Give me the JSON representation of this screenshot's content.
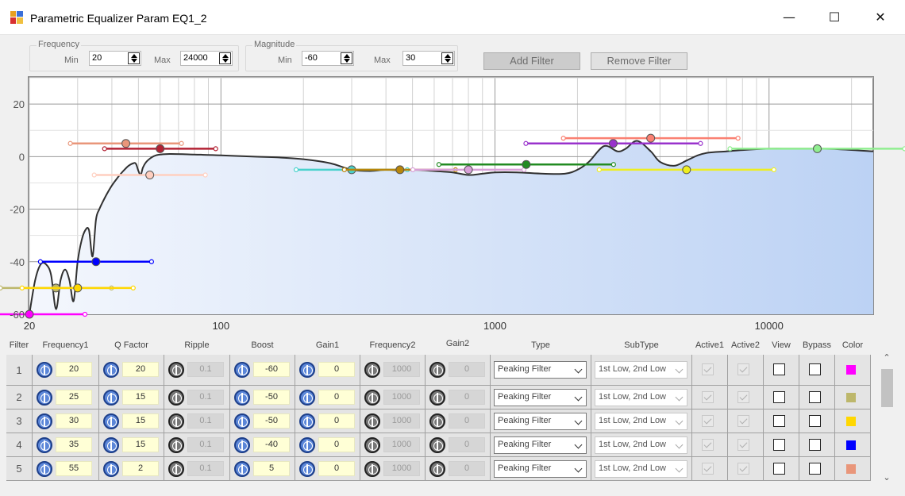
{
  "window": {
    "title": "Parametric Equalizer Param EQ1_2",
    "minimize_glyph": "—",
    "maximize_glyph": "☐",
    "close_glyph": "✕"
  },
  "frequency_group": {
    "label": "Frequency",
    "min_label": "Min",
    "min_value": "20",
    "max_label": "Max",
    "max_value": "24000"
  },
  "magnitude_group": {
    "label": "Magnitude",
    "min_label": "Min",
    "min_value": "-60",
    "max_label": "Max",
    "max_value": "30"
  },
  "buttons": {
    "add_filter": "Add Filter",
    "remove_filter": "Remove Filter"
  },
  "chart_data": {
    "type": "line",
    "x_scale": "log",
    "xlim": [
      20,
      24000
    ],
    "ylim": [
      -60,
      30
    ],
    "x_ticks": [
      20,
      100,
      1000,
      10000
    ],
    "x_tick_labels": [
      "20",
      "100",
      "1000",
      "10000"
    ],
    "y_ticks": [
      20,
      0,
      -20,
      -40,
      -60
    ],
    "y_tick_labels": [
      "20",
      "0",
      "-20",
      "-40",
      "-60"
    ],
    "grid": true,
    "series": [
      {
        "x": [
          20,
          21,
          22,
          23,
          24,
          25,
          26,
          27,
          28,
          29,
          30,
          31,
          32,
          33,
          34,
          35,
          36,
          38,
          40,
          42,
          44,
          46,
          48,
          49,
          50,
          51,
          52,
          54,
          58,
          65,
          80,
          100,
          130,
          160,
          200,
          250,
          300,
          350,
          400,
          450,
          500,
          600,
          700,
          800,
          900,
          1000,
          1200,
          1500,
          1800,
          2000,
          2200,
          2500,
          2800,
          3000,
          3300,
          3700,
          4000,
          4500,
          5000,
          5500,
          6000,
          7000,
          8000,
          10000,
          12000,
          15000,
          18000,
          24000
        ],
        "y": [
          -60,
          -47,
          -41,
          -41,
          -45,
          -58,
          -47,
          -43,
          -47,
          -55,
          -40,
          -32,
          -28,
          -28,
          -38,
          -24,
          -20,
          -15,
          -11,
          -8,
          -5.5,
          -3.5,
          -2.5,
          -2.8,
          -5.5,
          -7,
          -4,
          -1.5,
          0.5,
          1,
          0.8,
          0.5,
          0,
          -0.3,
          -1,
          -2.5,
          -5,
          -5.5,
          -5,
          -5.3,
          -5,
          -5.5,
          -6,
          -7,
          -6.5,
          -6,
          -6,
          -6.5,
          -6.5,
          -5,
          -2,
          4,
          2,
          3,
          6,
          2,
          -2,
          -3.5,
          -1.5,
          0.5,
          1.5,
          2,
          2.5,
          3,
          3,
          3,
          2.8,
          2
        ]
      }
    ],
    "filter_markers": [
      {
        "freq": 20,
        "gain": -60,
        "color": "#ff00ff"
      },
      {
        "freq": 25,
        "gain": -50,
        "color": "#bdb76b"
      },
      {
        "freq": 30,
        "gain": -50,
        "color": "#ffd700"
      },
      {
        "freq": 35,
        "gain": -40,
        "color": "#0000ff"
      },
      {
        "freq": 55,
        "gain": -7,
        "color": "#ffcfc0"
      },
      {
        "freq": 45,
        "gain": 5,
        "color": "#e9967a"
      },
      {
        "freq": 60,
        "gain": 3,
        "color": "#b22234"
      },
      {
        "freq": 300,
        "gain": -5,
        "color": "#48d1cc"
      },
      {
        "freq": 450,
        "gain": -5,
        "color": "#b8860b"
      },
      {
        "freq": 800,
        "gain": -5,
        "color": "#d8a0d8"
      },
      {
        "freq": 1300,
        "gain": -3,
        "color": "#228b22"
      },
      {
        "freq": 2700,
        "gain": 5,
        "color": "#9932cc"
      },
      {
        "freq": 3700,
        "gain": 7,
        "color": "#fa8072"
      },
      {
        "freq": 5000,
        "gain": -5,
        "color": "#eeee20"
      },
      {
        "freq": 15000,
        "gain": 3,
        "color": "#90ee90"
      }
    ]
  },
  "table": {
    "headers": {
      "filter": "Filter",
      "frequency1": "Frequency1",
      "q_factor": "Q Factor",
      "ripple": "Ripple",
      "boost": "Boost",
      "gain1": "Gain1",
      "frequency2": "Frequency2",
      "gain2": "Gain2",
      "type": "Type",
      "subtype": "SubType",
      "active1": "Active1",
      "active2": "Active2",
      "view": "View",
      "bypass": "Bypass",
      "color": "Color"
    },
    "rows": [
      {
        "num": "1",
        "freq1": "20",
        "q": "20",
        "ripple": "0.1",
        "boost": "-60",
        "gain1": "0",
        "freq2": "1000",
        "gain2": "0",
        "type": "Peaking Filter",
        "subtype": "1st Low, 2nd Low",
        "color": "#ff00ff"
      },
      {
        "num": "2",
        "freq1": "25",
        "q": "15",
        "ripple": "0.1",
        "boost": "-50",
        "gain1": "0",
        "freq2": "1000",
        "gain2": "0",
        "type": "Peaking Filter",
        "subtype": "1st Low, 2nd Low",
        "color": "#bdb76b"
      },
      {
        "num": "3",
        "freq1": "30",
        "q": "15",
        "ripple": "0.1",
        "boost": "-50",
        "gain1": "0",
        "freq2": "1000",
        "gain2": "0",
        "type": "Peaking Filter",
        "subtype": "1st Low, 2nd Low",
        "color": "#ffd700"
      },
      {
        "num": "4",
        "freq1": "35",
        "q": "15",
        "ripple": "0.1",
        "boost": "-40",
        "gain1": "0",
        "freq2": "1000",
        "gain2": "0",
        "type": "Peaking Filter",
        "subtype": "1st Low, 2nd Low",
        "color": "#0000ff"
      },
      {
        "num": "5",
        "freq1": "55",
        "q": "2",
        "ripple": "0.1",
        "boost": "5",
        "gain1": "0",
        "freq2": "1000",
        "gain2": "0",
        "type": "Peaking Filter",
        "subtype": "1st Low, 2nd Low",
        "color": "#e9967a"
      }
    ]
  },
  "scrollbar": {
    "up_glyph": "⌃",
    "down_glyph": "⌄"
  }
}
